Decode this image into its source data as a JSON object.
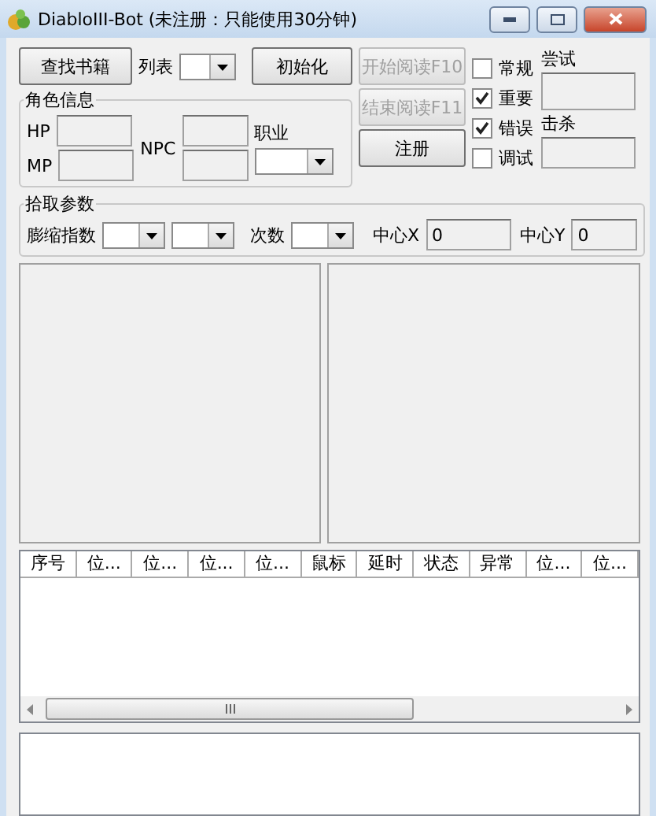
{
  "window": {
    "title": "DiabloIII-Bot (未注册：只能使用30分钟)"
  },
  "top_row": {
    "find_button": "查找书籍",
    "list_label": "列表",
    "init_button": "初始化"
  },
  "character_info": {
    "title": "角色信息",
    "hp_label": "HP",
    "mp_label": "MP",
    "npc_label": "NPC",
    "class_label": "职业"
  },
  "action_buttons": [
    {
      "label": "开始阅读F10",
      "disabled": true
    },
    {
      "label": "结束阅读F11",
      "disabled": true
    },
    {
      "label": "注册",
      "disabled": false
    }
  ],
  "checkboxes": [
    {
      "label": "常规",
      "checked": false
    },
    {
      "label": "重要",
      "checked": true
    },
    {
      "label": "错误",
      "checked": true
    },
    {
      "label": "调试",
      "checked": false
    }
  ],
  "stats": {
    "attempts_label": "尝试",
    "kills_label": "击杀"
  },
  "pickup_params": {
    "title": "拾取参数",
    "shrink_label": "膨缩指数",
    "count_label": "次数",
    "center_x_label": "中心X",
    "center_x_value": "0",
    "center_y_label": "中心Y",
    "center_y_value": "0"
  },
  "table": {
    "columns": [
      "序号",
      "位...",
      "位...",
      "位...",
      "位...",
      "鼠标",
      "延时",
      "状态",
      "异常",
      "位...",
      "位..."
    ]
  }
}
